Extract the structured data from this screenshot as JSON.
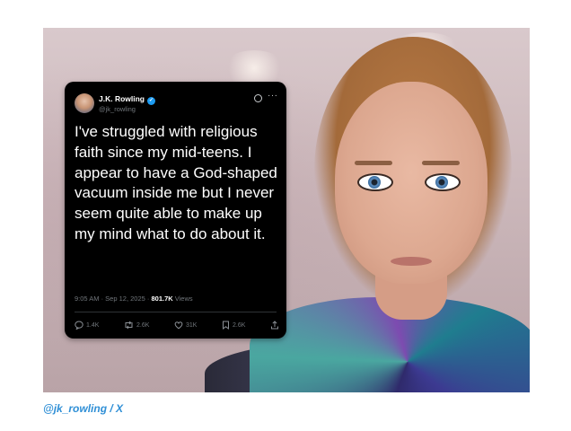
{
  "tweet": {
    "author_name": "J.K. Rowling",
    "handle": "@jk_rowling",
    "text": "I've struggled with religious faith since my mid-teens. I appear to have a God-shaped vacuum inside me but I never seem quite able to make up my mind what to do about it.",
    "timestamp": "9:05 AM · Sep 12, 2025 · ",
    "views_count": "801.7K",
    "views_label": " Views",
    "replies": "1.4K",
    "reposts": "2.6K",
    "likes": "31K",
    "bookmarks": "2.6K",
    "icons": {
      "verified": "verified-badge-icon",
      "grok": "grok-icon",
      "more": "more-icon",
      "reply": "reply-icon",
      "repost": "repost-icon",
      "like": "like-icon",
      "bookmark": "bookmark-icon",
      "share": "share-icon"
    }
  },
  "caption": "@jk_rowling / X",
  "colors": {
    "card_bg": "#000000",
    "verified": "#1d9bf0",
    "caption": "#2f8fd6"
  }
}
